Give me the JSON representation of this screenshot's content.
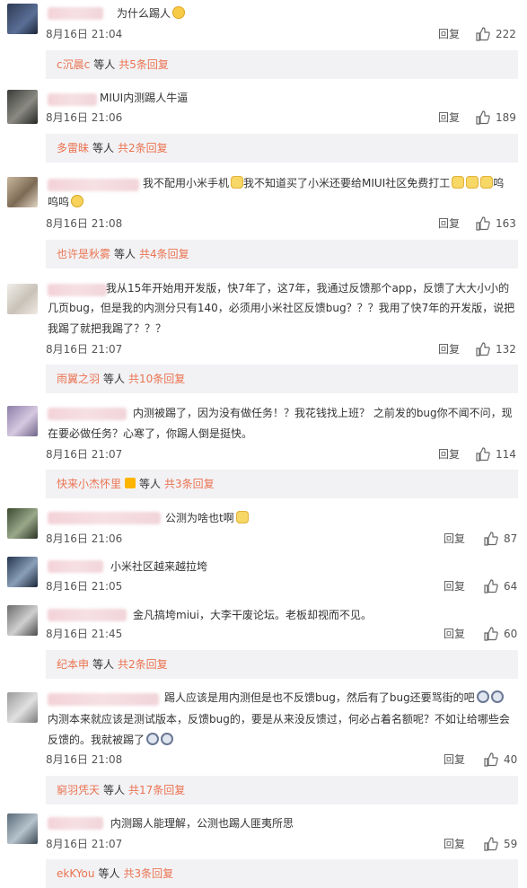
{
  "comments": [
    {
      "text": "为什么踢人",
      "emoji": [
        "surprise"
      ],
      "time": "8月16日 21:04",
      "reply": "回复",
      "likes": "222",
      "sub": {
        "who": "c沉晨c",
        "etc": "等人",
        "count": "共5条回复"
      }
    },
    {
      "text": "MIUI内测踢人牛逼",
      "emoji": [],
      "time": "8月16日 21:06",
      "reply": "回复",
      "likes": "189",
      "sub": {
        "who": "多雷昧",
        "etc": "等人",
        "count": "共2条回复"
      }
    },
    {
      "text": "我不配用小米手机",
      "text2": "我不知道买了小米还要给MIUI社区免费打工",
      "text3": "呜",
      "text4": "呜呜",
      "time": "8月16日 21:08",
      "reply": "回复",
      "likes": "163",
      "sub": {
        "who": "也许是秋雾",
        "etc": "等人",
        "count": "共4条回复"
      }
    },
    {
      "line1": "我从15年开始用开发版，快7年了，这7年，我通过反馈那个app，反馈了大大小小的",
      "line2": "几页bug，但是我的内测分只有140，必须用小米社区反馈bug？？？我用了快7年的开发版，说把",
      "line3": "我踢了就把我踢了？？？",
      "time": "8月16日 21:07",
      "reply": "回复",
      "likes": "132",
      "sub": {
        "who": "雨翼之羽",
        "etc": "等人",
        "count": "共10条回复"
      }
    },
    {
      "line1": "内测被踢了，因为没有做任务！？我花钱找上班？ 之前发的bug你不闻不问，现",
      "line2": "在要必做任务？心寒了，你踢人倒是挺快。",
      "time": "8月16日 21:07",
      "reply": "回复",
      "likes": "114",
      "sub": {
        "who": "快来小杰怀里",
        "etc": "等人",
        "count": "共3条回复"
      }
    },
    {
      "text": "公测为啥也t啊",
      "time": "8月16日 21:06",
      "reply": "回复",
      "likes": "87"
    },
    {
      "text": "小米社区越来越拉垮",
      "time": "8月16日 21:05",
      "reply": "回复",
      "likes": "64"
    },
    {
      "text": "金凡搞垮miui，大李干废论坛。老板却视而不见。",
      "time": "8月16日 21:45",
      "reply": "回复",
      "likes": "60",
      "sub": {
        "who": "纪本申",
        "etc": "等人",
        "count": "共2条回复"
      }
    },
    {
      "line1": "踢人应该是用内测但是也不反馈bug，然后有了bug还要骂街的吧",
      "line2": "内测本来就应该是测试版本，反馈bug的，要是从来没反馈过，何必占着名额呢？不如让给哪些会",
      "line3": "反馈的。我就被踢了",
      "time": "8月16日 21:08",
      "reply": "回复",
      "likes": "40",
      "sub": {
        "who": "窮羽凭天",
        "etc": "等人",
        "count": "共17条回复"
      }
    },
    {
      "text": "内测踢人能理解，公测也踢人匪夷所思",
      "time": "8月16日 21:07",
      "reply": "回复",
      "likes": "59",
      "sub": {
        "who": "ekKYou",
        "etc": "等人",
        "count": "共3条回复"
      }
    }
  ],
  "colors": {
    "accent": "#eb7350",
    "text": "#333333",
    "meta": "#555555",
    "subbar": "#f2f2f5"
  }
}
